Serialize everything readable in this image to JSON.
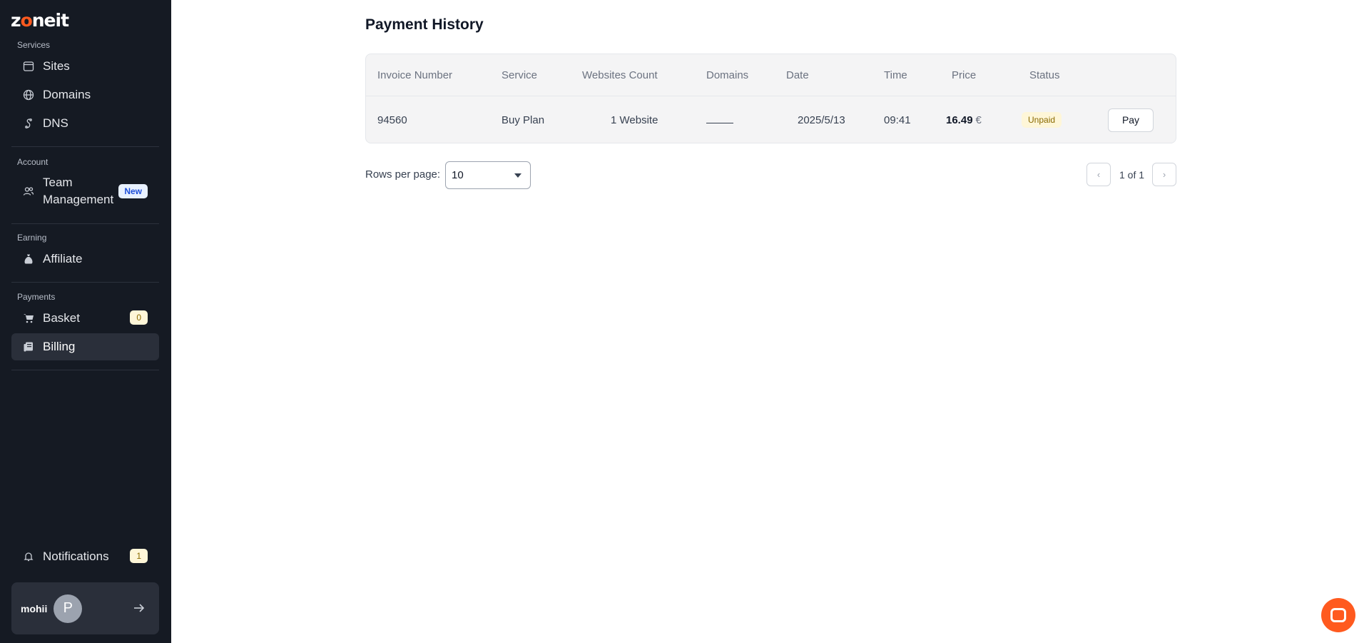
{
  "app": {
    "logo_text_a": "z",
    "logo_text_o": "o",
    "logo_text_b": "neit",
    "accent_color": "#ff5a1f"
  },
  "sidebar": {
    "services_title": "Services",
    "services": [
      {
        "label": "Sites",
        "icon": "browser-window-icon"
      },
      {
        "label": "Domains",
        "icon": "globe-icon"
      },
      {
        "label": "DNS",
        "icon": "dns-icon"
      }
    ],
    "account_title": "Account",
    "account": [
      {
        "label_line1": "Team",
        "label_line2": "Management",
        "icon": "team-icon",
        "badge": "New"
      }
    ],
    "earning_title": "Earning",
    "earning": [
      {
        "label": "Affiliate",
        "icon": "money-bag-icon"
      }
    ],
    "payments_title": "Payments",
    "payments": [
      {
        "label": "Basket",
        "icon": "cart-icon",
        "badge": "0"
      },
      {
        "label": "Billing",
        "icon": "billing-icon",
        "active": true
      }
    ],
    "notifications": {
      "label": "Notifications",
      "icon": "bell-icon",
      "badge": "1"
    },
    "user": {
      "name": "mohii",
      "avatar_initial": "P"
    }
  },
  "main": {
    "title": "Payment History",
    "table": {
      "headers": {
        "invoice": "Invoice Number",
        "service": "Service",
        "websites": "Websites Count",
        "domains": "Domains",
        "date": "Date",
        "time": "Time",
        "price": "Price",
        "status": "Status"
      },
      "rows": [
        {
          "invoice": "94560",
          "service": "Buy Plan",
          "websites": "1 Website",
          "domains": "",
          "date": "2025/5/13",
          "time": "09:41",
          "price": "16.49",
          "currency": "€",
          "status": "Unpaid",
          "action": "Pay"
        }
      ]
    },
    "pagination": {
      "rows_per_page_label": "Rows per page:",
      "rows_per_page_value": "10",
      "page_info": "1 of 1"
    }
  }
}
